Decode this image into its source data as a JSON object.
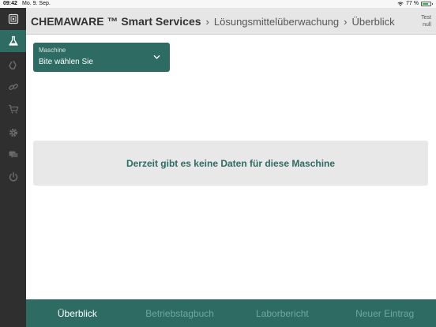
{
  "status_bar": {
    "time": "09:42",
    "date": "Mo. 9. Sep.",
    "battery_text": "77 %",
    "battery_level": 0.77
  },
  "sidebar": {
    "items": [
      {
        "icon": "app-icon",
        "active": false
      },
      {
        "icon": "flask-icon",
        "active": true
      },
      {
        "icon": "recycle-icon",
        "active": false
      },
      {
        "icon": "link-icon",
        "active": false
      },
      {
        "icon": "cart-icon",
        "active": false
      },
      {
        "icon": "gear-icon",
        "active": false
      },
      {
        "icon": "chat-icon",
        "active": false
      },
      {
        "icon": "power-icon",
        "active": false
      }
    ]
  },
  "header": {
    "app_title": "CHEMAWARE ™ Smart Services",
    "breadcrumb_1": "Lösungsmittelüberwachung",
    "breadcrumb_2": "Überblick",
    "user_line1": "Test",
    "user_line2": "null"
  },
  "machine_select": {
    "label": "Maschine",
    "value": "Bite wählen Sie"
  },
  "empty_message": "Derzeit gibt es keine Daten für diese Maschine",
  "tabs": [
    {
      "label": "Überblick",
      "active": true
    },
    {
      "label": "Betriebstagbuch",
      "active": false
    },
    {
      "label": "Laborbericht",
      "active": false
    },
    {
      "label": "Neuer Eintrag",
      "active": false
    }
  ],
  "colors": {
    "accent": "#2e6b62",
    "sidebar": "#2f2f2f",
    "header": "#e6e6e6"
  }
}
